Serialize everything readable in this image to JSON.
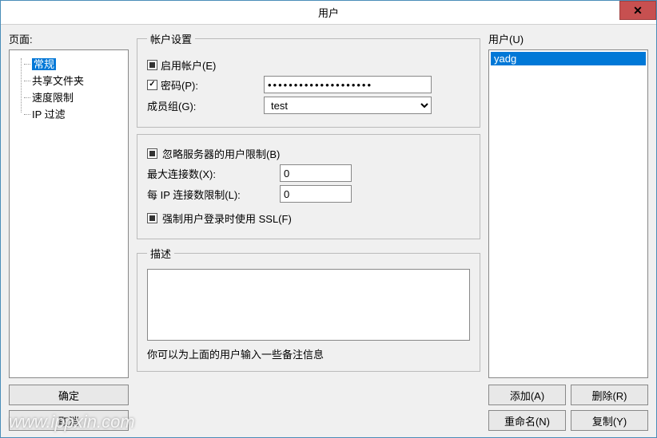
{
  "title": "用户",
  "sidebar": {
    "label": "页面:",
    "items": [
      {
        "label": "常规",
        "selected": true
      },
      {
        "label": "共享文件夹",
        "selected": false
      },
      {
        "label": "速度限制",
        "selected": false
      },
      {
        "label": "IP 过滤",
        "selected": false
      }
    ]
  },
  "buttons": {
    "ok": "确定",
    "cancel": "取消"
  },
  "account": {
    "legend": "帐户设置",
    "enable_label": "启用帐户(E)",
    "enable_checked": false,
    "password_label": "密码(P):",
    "password_checked": true,
    "password_value": "••••••••••••••••••••",
    "group_label": "成员组(G):",
    "group_value": "test"
  },
  "limits": {
    "bypass_label": "忽略服务器的用户限制(B)",
    "bypass_checked": false,
    "max_conn_label": "最大连接数(X):",
    "max_conn_value": "0",
    "per_ip_label": "每 IP 连接数限制(L):",
    "per_ip_value": "0",
    "force_ssl_label": "强制用户登录时使用 SSL(F)",
    "force_ssl_checked": false
  },
  "description": {
    "legend": "描述",
    "value": "",
    "hint": "你可以为上面的用户输入一些备注信息"
  },
  "users": {
    "label": "用户(U)",
    "items": [
      {
        "name": "yadg",
        "selected": true
      }
    ],
    "add": "添加(A)",
    "remove": "删除(R)",
    "rename": "重命名(N)",
    "copy": "复制(Y)"
  },
  "watermark": "www.ippxin.com"
}
